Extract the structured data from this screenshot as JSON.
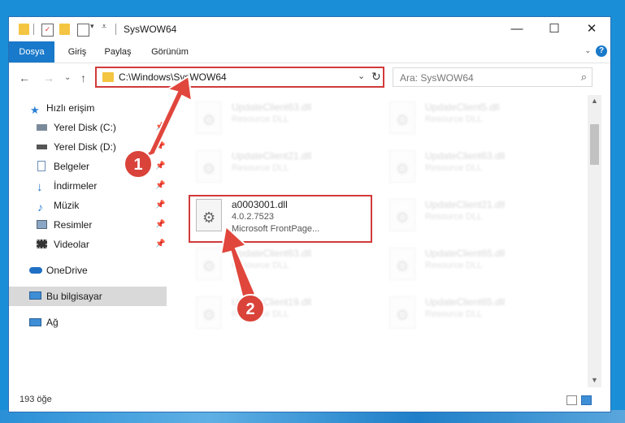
{
  "window": {
    "title": "SysWOW64",
    "minimize": "—",
    "maximize": "☐",
    "close": "✕"
  },
  "ribbon": {
    "tabs": [
      "Dosya",
      "Giriş",
      "Paylaş",
      "Görünüm"
    ],
    "help": "?"
  },
  "nav": {
    "back": "←",
    "forward": "→",
    "recent": "⌄",
    "up": "↑",
    "address": "C:\\Windows\\SysWOW64",
    "search_placeholder": "Ara: SysWOW64"
  },
  "sidebar": {
    "items": [
      {
        "label": "Hızlı erişim",
        "icon": "star-icon",
        "pinned": false
      },
      {
        "label": "Yerel Disk (C:)",
        "icon": "drive-icon",
        "pinned": true
      },
      {
        "label": "Yerel Disk (D:)",
        "icon": "drive-icon",
        "pinned": true
      },
      {
        "label": "Belgeler",
        "icon": "documents-icon",
        "pinned": true
      },
      {
        "label": "İndirmeler",
        "icon": "download-icon",
        "pinned": true
      },
      {
        "label": "Müzik",
        "icon": "music-icon",
        "pinned": true
      },
      {
        "label": "Resimler",
        "icon": "pictures-icon",
        "pinned": true
      },
      {
        "label": "Videolar",
        "icon": "videos-icon",
        "pinned": true
      },
      {
        "label": "OneDrive",
        "icon": "cloud-icon",
        "pinned": false
      },
      {
        "label": "Bu bilgisayar",
        "icon": "computer-icon",
        "pinned": false,
        "selected": true
      },
      {
        "label": "Ağ",
        "icon": "network-icon",
        "pinned": false
      }
    ]
  },
  "files": {
    "highlighted": {
      "name": "a0003001.dll",
      "version": "4.0.2.7523",
      "description": "Microsoft FrontPage..."
    },
    "blurred": [
      {
        "name": "UpdateClient63.dll",
        "type": "Resource DLL"
      },
      {
        "name": "UpdateClient5.dll",
        "type": "Resource DLL"
      },
      {
        "name": "UpdateClient21.dll",
        "type": "Resource DLL"
      },
      {
        "name": "UpdateClient63.dll",
        "type": "Resource DLL"
      },
      {
        "name": "UpdateClient21.dll",
        "type": "Resource DLL"
      },
      {
        "name": "UpdateClient63.dll",
        "type": "Resource DLL"
      },
      {
        "name": "UpdateClient65.dll",
        "type": "Resource DLL"
      },
      {
        "name": "UpdateClient19.dll",
        "type": "Resource DLL"
      },
      {
        "name": "UpdateClient65.dll",
        "type": "Resource DLL"
      }
    ]
  },
  "status": {
    "item_count": "193 öğe"
  },
  "markers": [
    "1",
    "2"
  ],
  "colors": {
    "accent": "#1979ca",
    "highlight": "#d13a3a"
  }
}
